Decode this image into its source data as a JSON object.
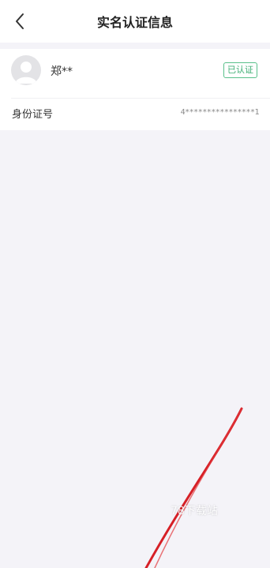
{
  "header": {
    "title": "实名认证信息",
    "back_icon": "chevron-left-icon"
  },
  "profile": {
    "avatar_icon": "default-avatar-icon",
    "name": "郑**",
    "status_badge": "已认证",
    "badge_color": "#3fae74"
  },
  "id_card": {
    "label": "身份证号",
    "value": "4****************1"
  },
  "overlay": {
    "text": "78下载站",
    "stroke_color": "#d61f26"
  }
}
